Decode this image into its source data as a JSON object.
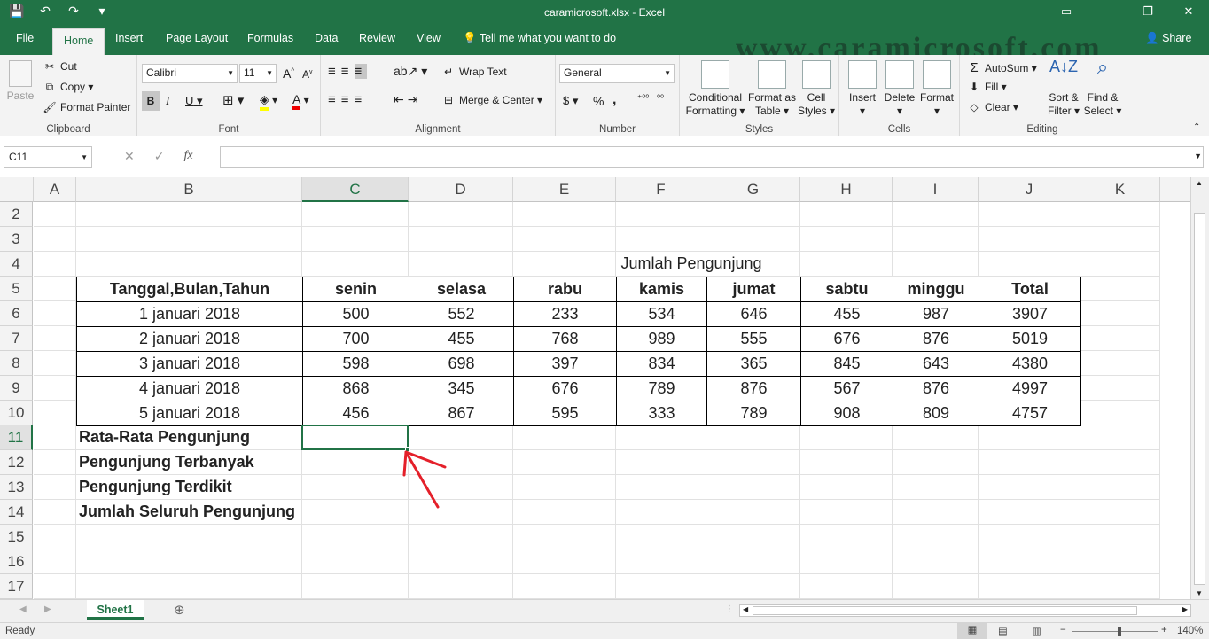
{
  "window": {
    "title": "caramicrosoft.xlsx  -  Excel",
    "watermark": "www.caramicrosoft.com"
  },
  "qat": {
    "save": "💾",
    "undo": "↶",
    "redo": "↷",
    "more": "▾"
  },
  "tabs": [
    "File",
    "Home",
    "Insert",
    "Page Layout",
    "Formulas",
    "Data",
    "Review",
    "View"
  ],
  "tell_me": "Tell me what you want to do",
  "share": "Share",
  "ribbon": {
    "clipboard": {
      "label": "Clipboard",
      "paste": "Paste",
      "cut": "Cut",
      "copy": "Copy",
      "format_painter": "Format Painter"
    },
    "font": {
      "label": "Font",
      "name": "Calibri",
      "size": "11",
      "bold": "B",
      "italic": "I",
      "underline": "U",
      "grow": "A",
      "shrink": "A"
    },
    "alignment": {
      "label": "Alignment",
      "wrap": "Wrap Text",
      "merge": "Merge & Center"
    },
    "number": {
      "label": "Number",
      "format": "General",
      "currency": "$",
      "percent": "%",
      "comma": ",",
      "inc_dec": "⁺⁰⁰",
      "dec_dec": "⁰⁰"
    },
    "styles": {
      "label": "Styles",
      "cond1": "Conditional",
      "cond2": "Formatting",
      "fmt1": "Format as",
      "fmt2": "Table",
      "cell1": "Cell",
      "cell2": "Styles"
    },
    "cells": {
      "label": "Cells",
      "insert": "Insert",
      "delete": "Delete",
      "format": "Format"
    },
    "editing": {
      "label": "Editing",
      "autosum": "AutoSum",
      "fill": "Fill",
      "clear": "Clear",
      "sort1": "Sort &",
      "sort2": "Filter",
      "find1": "Find &",
      "find2": "Select"
    }
  },
  "formula_bar": {
    "name_box": "C11",
    "fx": "fx",
    "value": ""
  },
  "columns": [
    "A",
    "B",
    "C",
    "D",
    "E",
    "F",
    "G",
    "H",
    "I",
    "J",
    "K"
  ],
  "rows": [
    "2",
    "3",
    "4",
    "5",
    "6",
    "7",
    "8",
    "9",
    "10",
    "11",
    "12",
    "13",
    "14",
    "15",
    "16",
    "17"
  ],
  "sheet": {
    "title": "Jumlah Pengunjung",
    "headers": [
      "Tanggal,Bulan,Tahun",
      "senin",
      "selasa",
      "rabu",
      "kamis",
      "jumat",
      "sabtu",
      "minggu",
      "Total"
    ],
    "data": [
      [
        "1 januari 2018",
        "500",
        "552",
        "233",
        "534",
        "646",
        "455",
        "987",
        "3907"
      ],
      [
        "2 januari 2018",
        "700",
        "455",
        "768",
        "989",
        "555",
        "676",
        "876",
        "5019"
      ],
      [
        "3 januari 2018",
        "598",
        "698",
        "397",
        "834",
        "365",
        "845",
        "643",
        "4380"
      ],
      [
        "4 januari 2018",
        "868",
        "345",
        "676",
        "789",
        "876",
        "567",
        "876",
        "4997"
      ],
      [
        "5 januari 2018",
        "456",
        "867",
        "595",
        "333",
        "789",
        "908",
        "809",
        "4757"
      ]
    ],
    "summary": [
      "Rata-Rata Pengunjung",
      "Pengunjung Terbanyak",
      "Pengunjung Terdikit",
      "Jumlah Seluruh Pengunjung"
    ]
  },
  "sheet_tabs": [
    "Sheet1"
  ],
  "status": {
    "text": "Ready",
    "zoom": "140%"
  },
  "accent": "#217346"
}
